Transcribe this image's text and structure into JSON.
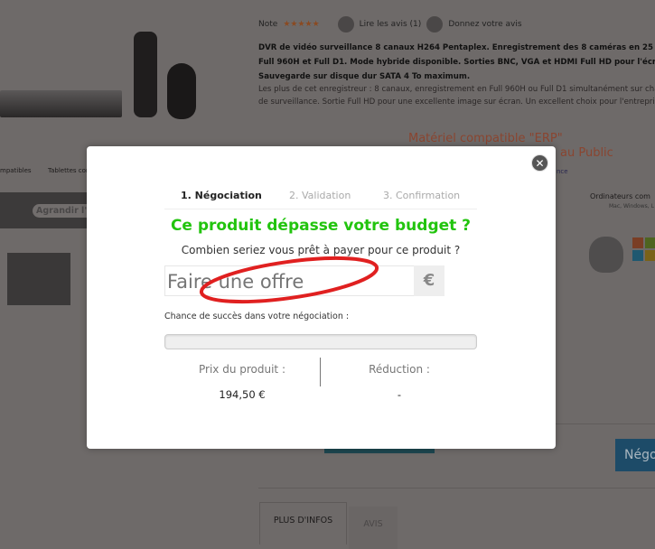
{
  "background": {
    "rating_label": "Note",
    "stars": "★★★★★",
    "read_reviews": "Lire les avis (1)",
    "give_review": "Donnez votre avis",
    "description_bold": [
      "DVR de vidéo surveillance 8 canaux H264 Pentaplex. Enregistrement des 8 caméras en 25 images",
      "Full 960H et Full D1. Mode hybride disponible. Sorties BNC, VGA et HDMI Full HD pour l'écran de",
      "Sauvegarde sur disque dur SATA 4 To maximum."
    ],
    "description": [
      "Les plus de cet enregistreur : 8 canaux, enregistrement en Full 960H ou Full D1 simultanément sur cha",
      "de surveillance. Sortie Full HD pour une excellente image sur écran. Un excellent choix pour l'entreprise"
    ],
    "erp_title": "Matériel compatible \"ERP\"",
    "erp_sub": "au Public",
    "erp_small": "nce",
    "compatible_phones": "mpatibles",
    "compatible_tablets": "Tablettes comp",
    "enlarge_image": "Agrandir l'im",
    "computers": "Ordinateurs com",
    "computers_sub": "Mac, Windows, L",
    "negotiate_button": "Négo",
    "tabs": [
      "PLUS D'INFOS",
      "AVIS"
    ]
  },
  "modal": {
    "steps": [
      "1. Négociation",
      "2. Validation",
      "3. Confirmation"
    ],
    "active_step": 0,
    "heading": "Ce produit dépasse votre budget ?",
    "subheading": "Combien seriez vous prêt à payer pour ce produit ?",
    "offer_placeholder": "Faire une offre",
    "currency": "€",
    "chance_label": "Chance de succès dans votre négociation :",
    "chance_progress_percent": 0,
    "price_label": "Prix du produit :",
    "price_value": "194,50 €",
    "reduction_label": "Réduction :",
    "reduction_value": "-",
    "colors": {
      "heading": "#22c40e",
      "annotation": "#e02020"
    }
  }
}
